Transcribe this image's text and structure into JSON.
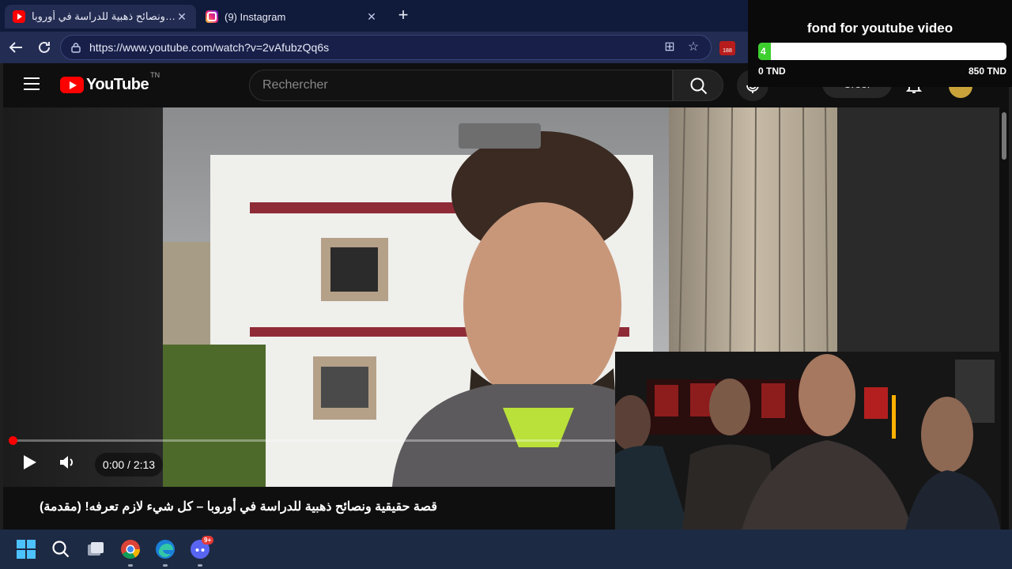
{
  "browser": {
    "tabs": [
      {
        "title": "قصة حقيقية ونصائح ذهبية للدراسة في أوروبا",
        "favicon": "youtube-favicon",
        "active": true
      },
      {
        "title": "(9) Instagram",
        "favicon": "instagram-favicon",
        "active": false
      }
    ],
    "address_bar": {
      "url": "https://www.youtube.com/watch?v=2vAfubzQq6s"
    },
    "extension_badge": "188"
  },
  "donation": {
    "title": "fond for youtube video",
    "current": "4",
    "progress_fraction": 0.01,
    "min_label": "0 TND",
    "max_label": "850 TND",
    "fill_color": "#3ccf2e"
  },
  "youtube": {
    "logo_text": "YouTube",
    "country_code": "TN",
    "search_placeholder": "Rechercher",
    "create_label": "Créer",
    "player": {
      "time": "0:00 / 2:13",
      "progress_fraction": 0.0
    },
    "video_title": "قصة حقيقية ونصائح ذهبية للدراسة في أوروبا – كل شيء لازم تعرفه! (مقدمة)"
  },
  "taskbar": {
    "icons": [
      "windows-start-icon",
      "search-icon",
      "task-view-icon",
      "chrome-icon",
      "edge-icon",
      "discord-icon"
    ],
    "discord_badge": "9+"
  },
  "colors": {
    "accent_red": "#ff0000",
    "tabstrip": "#101a3a",
    "taskbar": "#1d2a44"
  }
}
